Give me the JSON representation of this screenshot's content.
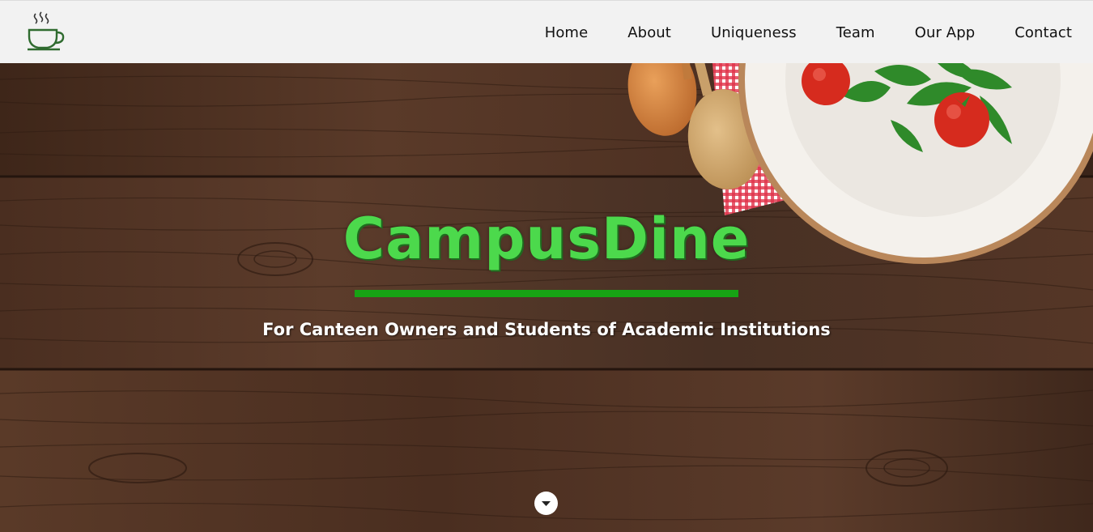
{
  "nav": {
    "logo_icon": "coffee-cup-icon",
    "links": [
      {
        "label": "Home"
      },
      {
        "label": "About"
      },
      {
        "label": "Uniqueness"
      },
      {
        "label": "Team"
      },
      {
        "label": "Our App"
      },
      {
        "label": "Contact"
      }
    ]
  },
  "hero": {
    "title": "CampusDine",
    "tagline": "For Canteen Owners and Students of Academic Institutions",
    "scroll_icon": "caret-down-icon"
  },
  "colors": {
    "title_green": "#4cd94c",
    "underline_green": "#17a314",
    "navbar_bg": "#f2f2f2",
    "wood": "#4a2f21",
    "logo_green": "#2f6b2f"
  }
}
